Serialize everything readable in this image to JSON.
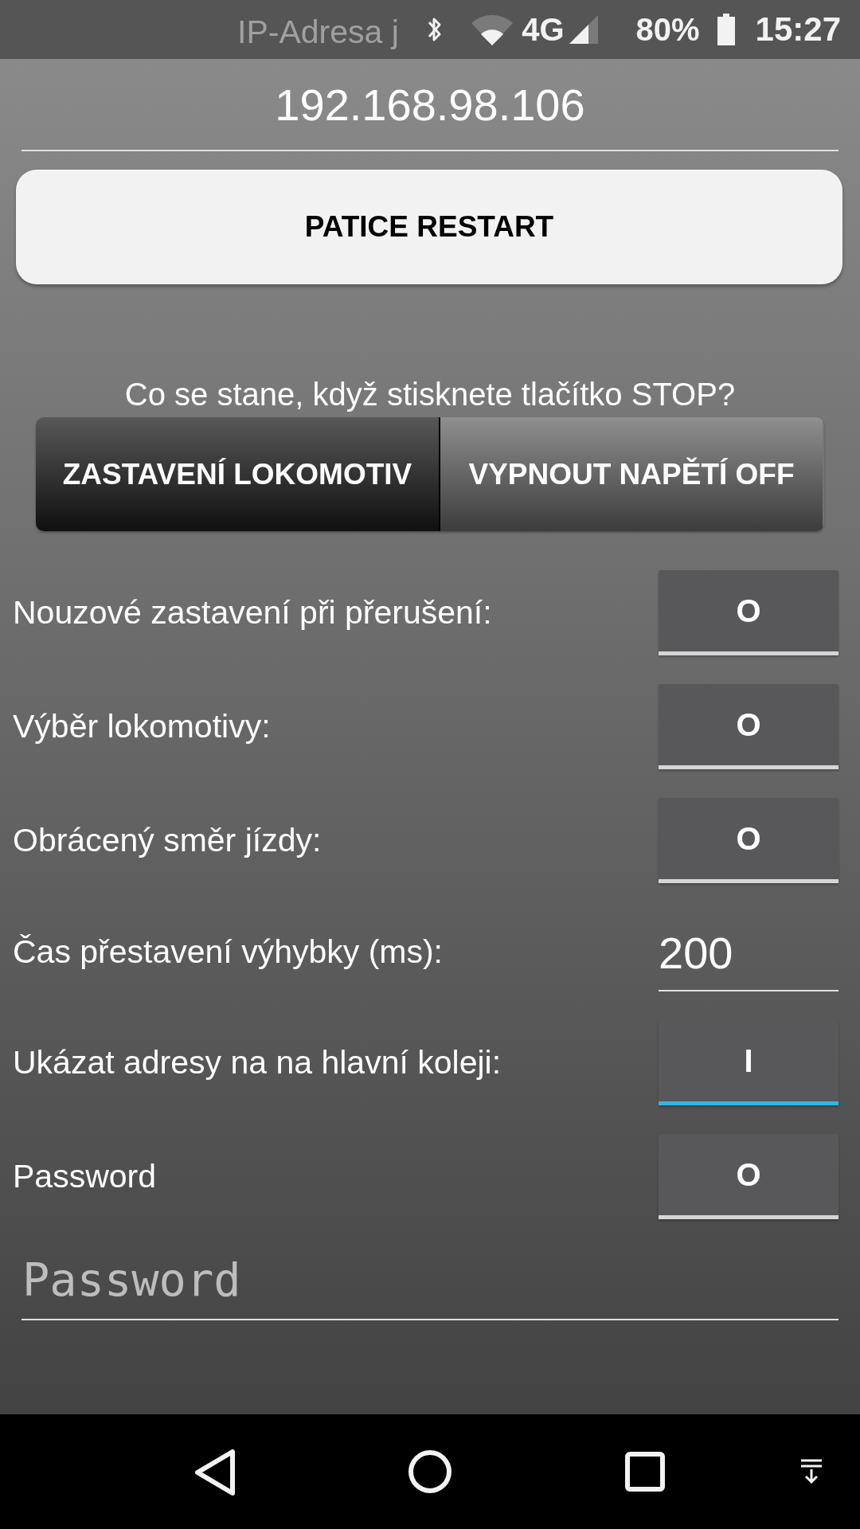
{
  "status_bar": {
    "network": "4G",
    "battery": "80%",
    "time": "15:27"
  },
  "header": {
    "title": "IP-Adresa j",
    "ip_address": "192.168.98.106"
  },
  "restart_button": {
    "label": "PATICE RESTART"
  },
  "stop_mode": {
    "question": "Co se stane, když stisknete tlačítko STOP?",
    "options": [
      {
        "label": "ZASTAVENÍ LOKOMOTIV",
        "selected": true
      },
      {
        "label": "VYPNOUT NAPĚTÍ OFF",
        "selected": false
      }
    ]
  },
  "settings": [
    {
      "kind": "toggle",
      "label": "Nouzové zastavení při přerušení:",
      "value": "O",
      "on": false
    },
    {
      "kind": "toggle",
      "label": "Výběr lokomotivy:",
      "value": "O",
      "on": false
    },
    {
      "kind": "toggle",
      "label": "Obrácený směr jízdy:",
      "value": "O",
      "on": false
    },
    {
      "kind": "number",
      "label": "Čas přestavení výhybky (ms):",
      "value": "200"
    },
    {
      "kind": "toggle",
      "label": "Ukázat adresy na na hlavní koleji:",
      "value": "I",
      "on": true
    },
    {
      "kind": "toggle",
      "label": "Password",
      "value": "O",
      "on": false
    }
  ],
  "password_field": {
    "placeholder": "Password"
  }
}
